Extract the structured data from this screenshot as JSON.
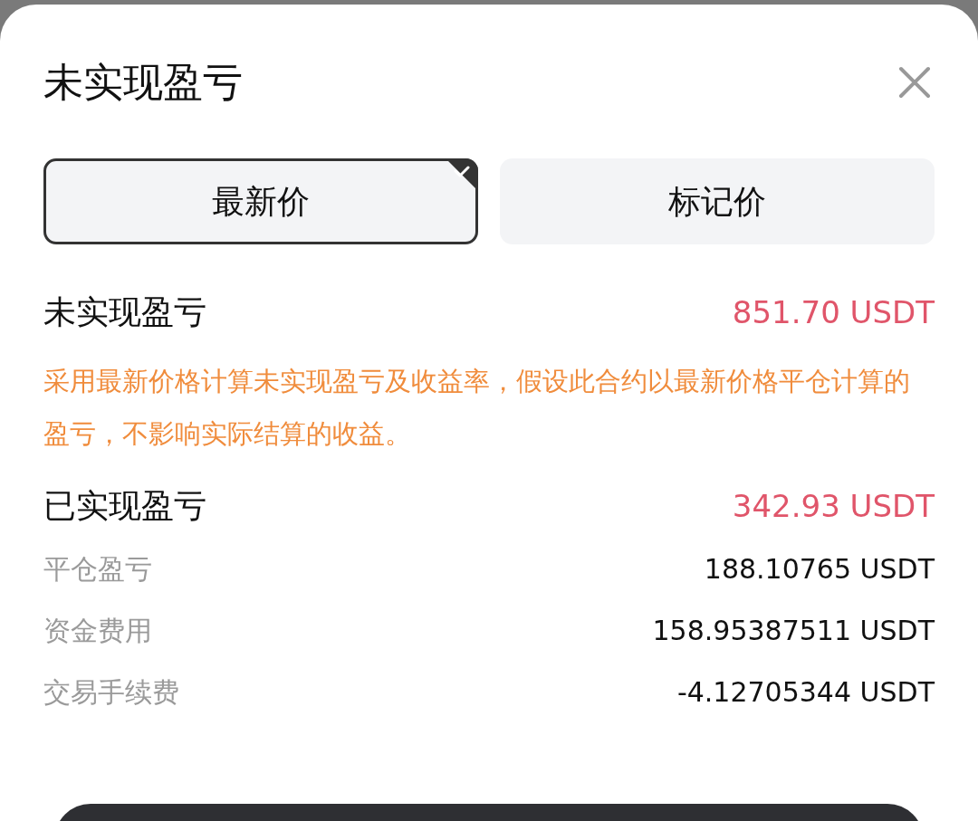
{
  "title": "未实现盈亏",
  "tabs": [
    {
      "label": "最新价",
      "selected": true
    },
    {
      "label": "标记价",
      "selected": false
    }
  ],
  "unrealized": {
    "label": "未实现盈亏",
    "value": "851.70 USDT"
  },
  "note": "采用最新价格计算未实现盈亏及收益率，假设此合约以最新价格平仓计算的盈亏，不影响实际结算的收益。",
  "realized": {
    "label": "已实现盈亏",
    "value": "342.93 USDT",
    "breakdown": [
      {
        "label": "平仓盈亏",
        "value": "188.10765 USDT"
      },
      {
        "label": "资金费用",
        "value": "158.95387511 USDT"
      },
      {
        "label": "交易手续费",
        "value": "-4.12705344 USDT"
      }
    ]
  }
}
